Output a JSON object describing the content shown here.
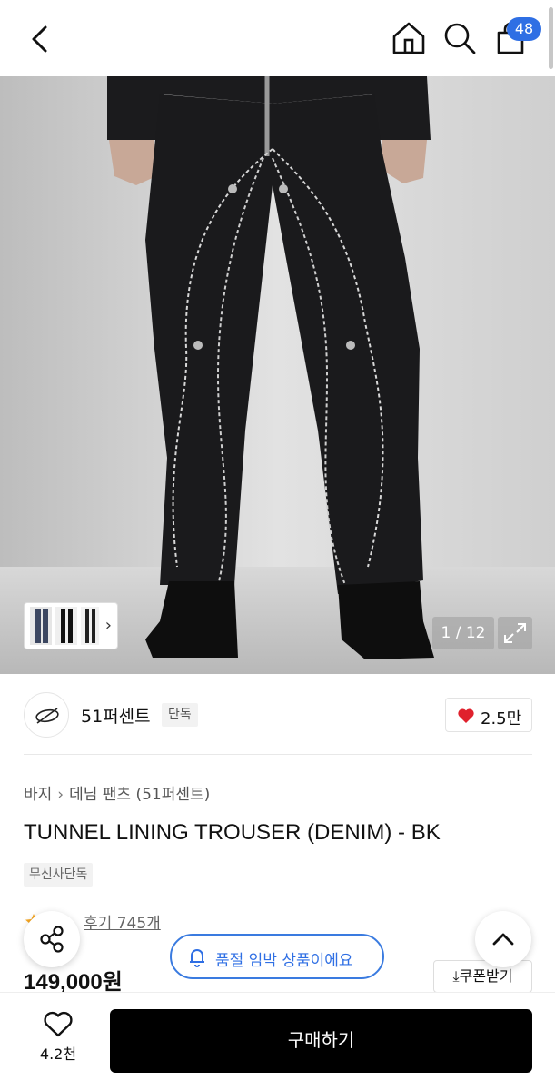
{
  "header": {
    "back_icon": "chevron-left-icon",
    "home_icon": "home-icon",
    "search_icon": "search-icon",
    "cart_icon": "shopping-bag-icon",
    "cart_count": "48",
    "accent": "#2f6fe4"
  },
  "gallery": {
    "counter": "1 / 12",
    "expand_icon": "expand-icon",
    "thumb_chevron": "›"
  },
  "brand": {
    "name": "51퍼센트",
    "tag": "단독",
    "like_count": "2.5만",
    "heart_color": "#e0212d"
  },
  "breadcrumb": {
    "items": [
      "바지",
      "데님 팬츠 (51퍼센트)"
    ],
    "separator": "›"
  },
  "product": {
    "title": "TUNNEL LINING TROUSER (DENIM) - BK",
    "exclusive_tag": "무신사단독",
    "rating_partial": "",
    "review_label": "후기 745개",
    "price": "149,000원",
    "coupon_label": "쿠폰받기",
    "coupon_icon": "download-icon"
  },
  "toast": {
    "icon": "bell-icon",
    "text": "품절 임박 상품이에요",
    "color": "#2f6fe4"
  },
  "fabs": {
    "share_icon": "share-icon",
    "up_icon": "chevron-up-icon"
  },
  "bottom": {
    "wish_icon": "heart-outline-icon",
    "wish_count": "4.2천",
    "buy_label": "구매하기"
  }
}
